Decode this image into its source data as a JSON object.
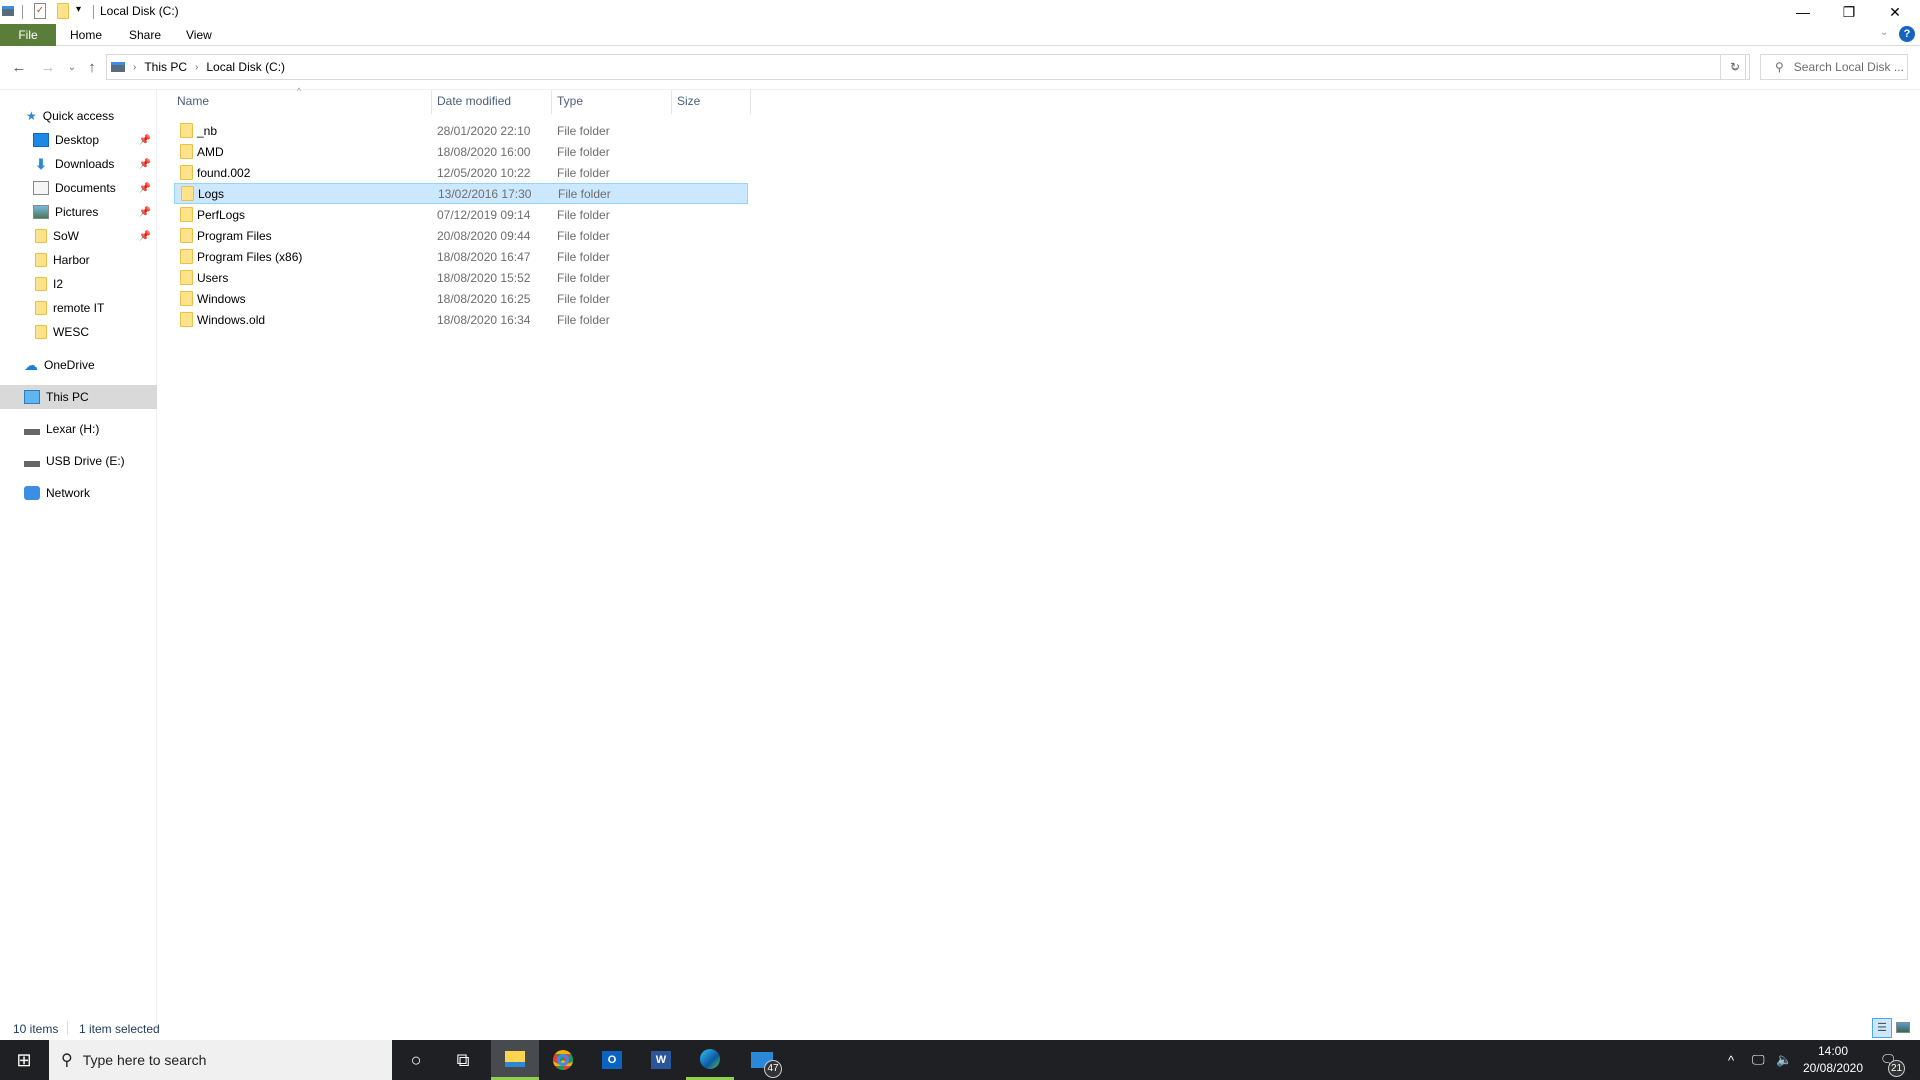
{
  "window": {
    "title": "Local Disk (C:)",
    "minimize": "—",
    "restore": "❐",
    "close": "✕"
  },
  "ribbon": {
    "tabs": [
      {
        "label": "File"
      },
      {
        "label": "Home"
      },
      {
        "label": "Share"
      },
      {
        "label": "View"
      }
    ],
    "help": "?"
  },
  "address": {
    "crumbs": [
      "This PC",
      "Local Disk (C:)"
    ],
    "search_placeholder": "Search Local Disk ..."
  },
  "sidebar": {
    "quick_access": "Quick access",
    "pinned": [
      {
        "label": "Desktop",
        "pinned": true
      },
      {
        "label": "Downloads",
        "pinned": true
      },
      {
        "label": "Documents",
        "pinned": true
      },
      {
        "label": "Pictures",
        "pinned": true
      },
      {
        "label": "SoW",
        "pinned": true
      },
      {
        "label": "Harbor"
      },
      {
        "label": "I2"
      },
      {
        "label": "remote IT"
      },
      {
        "label": "WESC"
      }
    ],
    "onedrive": "OneDrive",
    "this_pc": "This PC",
    "lexar": "Lexar (H:)",
    "usb": "USB Drive (E:)",
    "network": "Network"
  },
  "columns": {
    "name": "Name",
    "date": "Date modified",
    "type": "Type",
    "size": "Size"
  },
  "files": [
    {
      "name": "_nb",
      "date": "28/01/2020 22:10",
      "type": "File folder"
    },
    {
      "name": "AMD",
      "date": "18/08/2020 16:00",
      "type": "File folder"
    },
    {
      "name": "found.002",
      "date": "12/05/2020 10:22",
      "type": "File folder"
    },
    {
      "name": "Logs",
      "date": "13/02/2016 17:30",
      "type": "File folder",
      "selected": true
    },
    {
      "name": "PerfLogs",
      "date": "07/12/2019 09:14",
      "type": "File folder"
    },
    {
      "name": "Program Files",
      "date": "20/08/2020 09:44",
      "type": "File folder"
    },
    {
      "name": "Program Files (x86)",
      "date": "18/08/2020 16:47",
      "type": "File folder"
    },
    {
      "name": "Users",
      "date": "18/08/2020 15:52",
      "type": "File folder"
    },
    {
      "name": "Windows",
      "date": "18/08/2020 16:25",
      "type": "File folder"
    },
    {
      "name": "Windows.old",
      "date": "18/08/2020 16:34",
      "type": "File folder"
    }
  ],
  "status": {
    "count": "10 items",
    "selected": "1 item selected"
  },
  "taskbar": {
    "search_placeholder": "Type here to search",
    "mail_badge": "47",
    "time": "14:00",
    "date": "20/08/2020",
    "notifications": "21"
  },
  "colors": {
    "file_tab": "#5a7e3a",
    "selection": "#cce8ff",
    "taskbar": "#1f2023"
  }
}
